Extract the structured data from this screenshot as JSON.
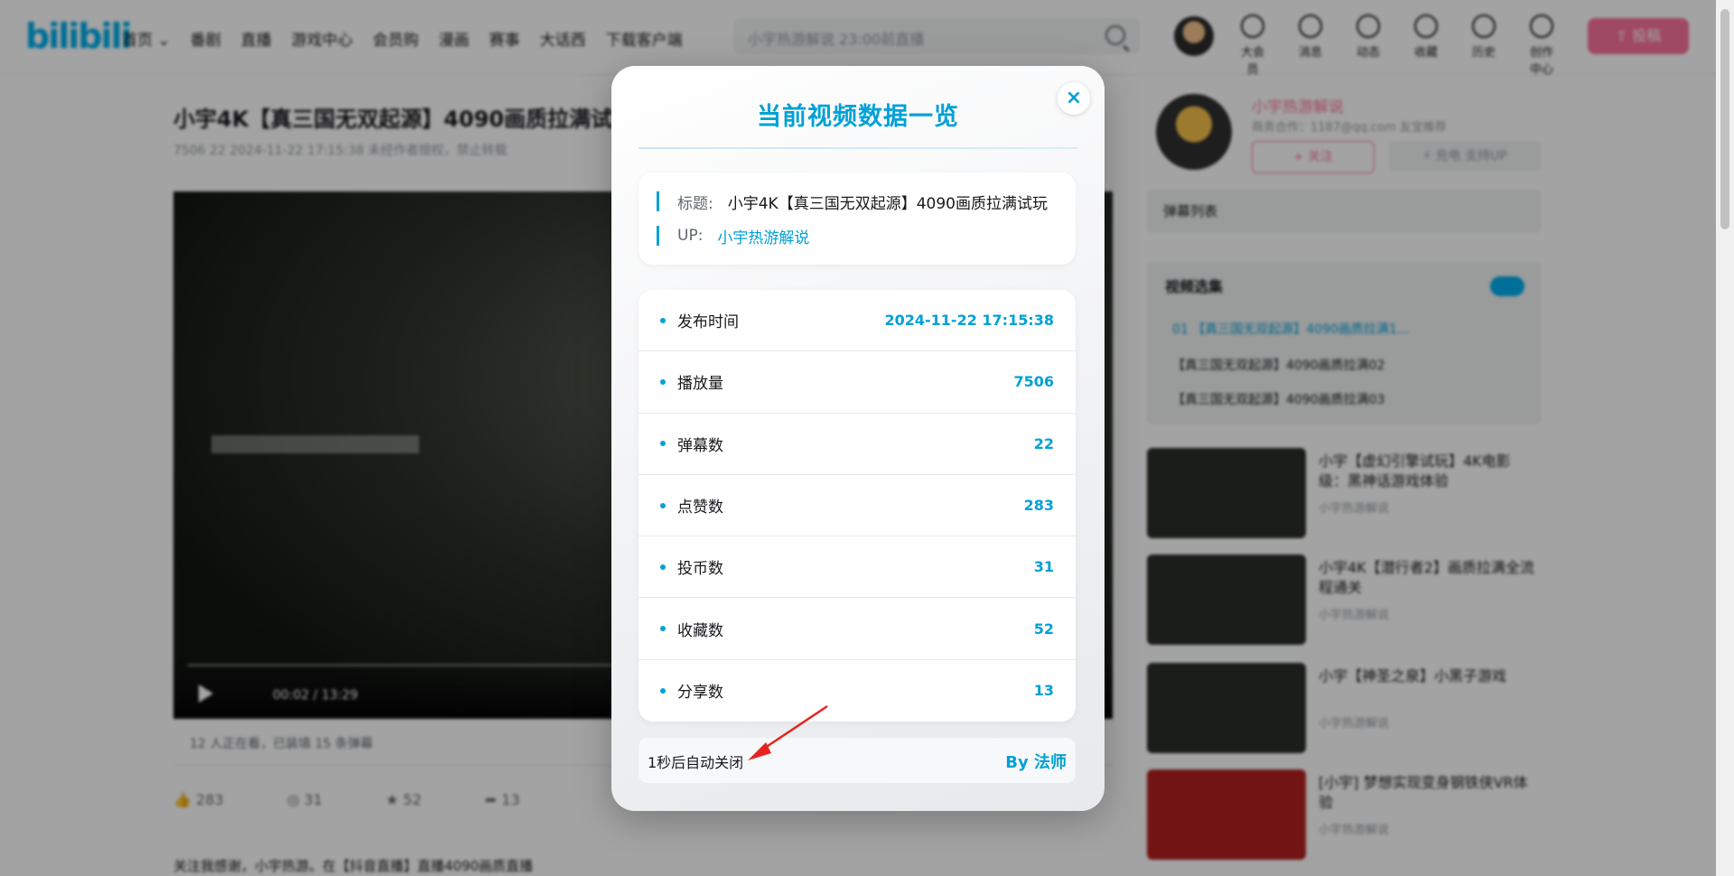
{
  "header": {
    "logo": "bilibili",
    "nav": [
      "首页 ⌄",
      "番剧",
      "直播",
      "游戏中心",
      "会员购",
      "漫画",
      "赛事",
      "大话西",
      "下载客户端"
    ],
    "search_placeholder": "小宇热游解说 23:00前直播",
    "right_icons": [
      {
        "icon": "vip-icon",
        "label": "大会员"
      },
      {
        "icon": "message-icon",
        "label": "消息"
      },
      {
        "icon": "dynamic-icon",
        "label": "动态"
      },
      {
        "icon": "favorite-icon",
        "label": "收藏"
      },
      {
        "icon": "history-icon",
        "label": "历史"
      },
      {
        "icon": "creator-icon",
        "label": "创作中心"
      }
    ],
    "upload_label": "⇧ 投稿"
  },
  "video": {
    "title": "小宇4K【真三国无双起源】4090画质拉满试",
    "meta": "7506   22   2024-11-22 17:15:38   未经作者授权，禁止转载",
    "time": "00:02 / 13:29",
    "viewers": "12 人正在看，已装填 15 条弹幕",
    "actions": [
      "283",
      "31",
      "52",
      "13"
    ],
    "desc": "关注我感谢，小宇热游。在【抖音直播】直播4090画质直播"
  },
  "sidebar": {
    "up_name": "小宇热游解说",
    "up_sig": "商务合作：1187@qq.com 友宝推荐",
    "follow_label": "+ 关注",
    "charge_label": "⚡ 充电 支持UP",
    "playlist": "弹幕列表",
    "collection_title": "视频选集",
    "collection_items": [
      "01 【真三国无双起源】4090画质拉满1...",
      "【真三国无双起源】4090画质拉满02",
      "【真三国无双起源】4090画质拉满03"
    ],
    "recommended": [
      {
        "title": "小宇【虚幻引擎试玩】4K电影级：黑神话游戏体验",
        "meta": "小宇热游解说"
      },
      {
        "title": "小宇4K【潜行者2】画质拉满全流程通关",
        "meta": "小宇热游解说"
      },
      {
        "title": "小宇【神圣之泉】小黑子游戏",
        "meta": "小宇热游解说"
      },
      {
        "title": "[小宇] 梦想实现变身钢铁侠VR体验",
        "meta": "小宇热游解说"
      }
    ]
  },
  "modal": {
    "title": "当前视频数据一览",
    "close_symbol": "×",
    "info": [
      {
        "label": "标题:",
        "value": "小宇4K【真三国无双起源】4090画质拉满试玩"
      },
      {
        "label": "UP:",
        "value": "小宇热游解说"
      }
    ],
    "stats": [
      {
        "label": "发布时间",
        "value": "2024-11-22 17:15:38"
      },
      {
        "label": "播放量",
        "value": "7506"
      },
      {
        "label": "弹幕数",
        "value": "22"
      },
      {
        "label": "点赞数",
        "value": "283"
      },
      {
        "label": "投币数",
        "value": "31"
      },
      {
        "label": "收藏数",
        "value": "52"
      },
      {
        "label": "分享数",
        "value": "13"
      }
    ],
    "footer_left": "1秒后自动关闭",
    "footer_right": "By 法师"
  },
  "colors": {
    "accent": "#00a1d6",
    "brand_pink": "#fb7299",
    "arrow": "#e8231f"
  }
}
